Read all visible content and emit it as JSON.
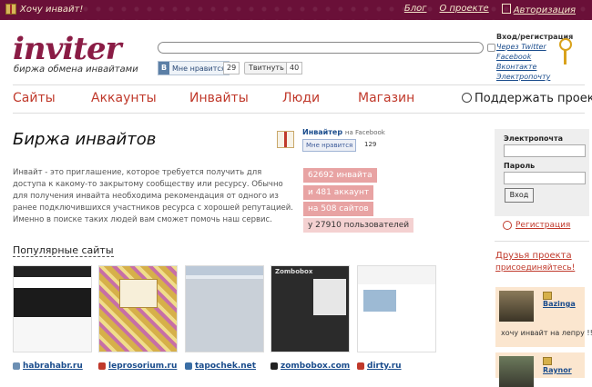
{
  "topbar": {
    "want_invite": "Хочу инвайт!",
    "nav": [
      "Блог",
      "О проекте",
      "Авторизация"
    ]
  },
  "header": {
    "logo": "inviter",
    "tagline": "биржа обмена инвайтами",
    "search_placeholder": "",
    "vk_label": "Мне нравится",
    "vk_count": "29",
    "tweet_label": "Твитнуть",
    "tweet_count": "40",
    "login": {
      "title": "Вход/регистрация",
      "links": [
        "Через Twitter",
        "Facebook",
        "Вконтакте",
        "Электропочту"
      ]
    }
  },
  "menu": {
    "items": [
      "Сайты",
      "Аккаунты",
      "Инвайты",
      "Люди",
      "Магазин"
    ],
    "support": "Поддержать проект!"
  },
  "main": {
    "title": "Биржа инвайтов",
    "description": "Инвайт - это приглашение, которое требуется получить для доступа к какому-то закрытому сообществу или ресурсу. Обычно для получения инвайта необходима рекомендация от одного из ранее подключившихся участников ресурса с хорошей репутацией. Именно в поиске таких людей вам сможет помочь наш сервис.",
    "facebook": {
      "name": "Инвайтер",
      "suffix": "на Facebook",
      "like": "Мне нравится",
      "count": "129"
    },
    "stats": [
      "62692 инвайта",
      "и 481 аккаунт",
      "на 508 сайтов",
      "у 27910 пользователей"
    ],
    "popular_title": "Популярные сайты",
    "sites": [
      {
        "name": "habrahabr.ru",
        "color": "#6c8fb3"
      },
      {
        "name": "leprosorium.ru",
        "color": "#c0392b"
      },
      {
        "name": "tapochek.net",
        "color": "#3a6ea5"
      },
      {
        "name": "zombobox.com",
        "color": "#222222"
      },
      {
        "name": "dirty.ru",
        "color": "#c0392b"
      }
    ],
    "zombobox_logo": "Zombobox"
  },
  "sidebar": {
    "email_label": "Электропочта",
    "password_label": "Пароль",
    "login_button": "Вход",
    "register": "Регистрация",
    "friends_title": "Друзья проекта",
    "join": "присоединяйтесь!",
    "cards": [
      {
        "user": "Bazinga",
        "message": "хочу инвайт на лепру !!"
      },
      {
        "user": "Raynor",
        "message": ""
      }
    ]
  }
}
